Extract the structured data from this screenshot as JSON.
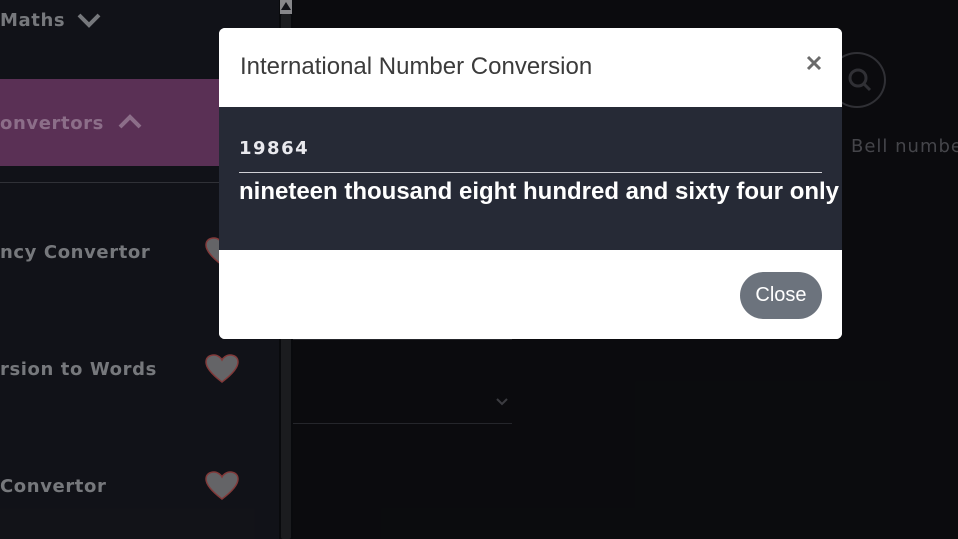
{
  "sidebar": {
    "maths_label": "Maths",
    "active_label": "onvertors",
    "items": [
      {
        "label": "ncy Convertor"
      },
      {
        "label": "rsion to Words"
      },
      {
        "label": "Convertor"
      }
    ]
  },
  "main": {
    "bell_text": "Bell numbe"
  },
  "modal": {
    "title": "International Number Conversion",
    "close_icon": "×",
    "number": "19864",
    "words": "nineteen thousand eight hundred and sixty four only",
    "close_button": "Close"
  },
  "colors": {
    "active_bg": "#8a4a83",
    "modal_body_bg": "#262a36",
    "close_button_bg": "#6c737d"
  }
}
